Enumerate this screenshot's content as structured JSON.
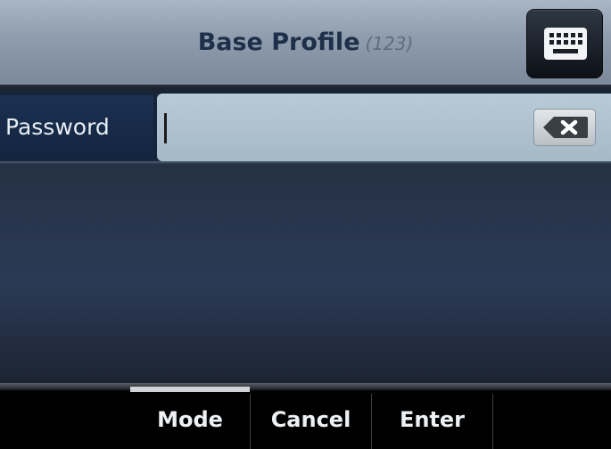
{
  "header": {
    "title": "Base Profile",
    "subtitle": "(123)",
    "keyboard_icon": "keyboard-icon"
  },
  "password_field": {
    "label": "Password",
    "value": "",
    "backspace_icon": "backspace-icon"
  },
  "softkeys": [
    {
      "label": ""
    },
    {
      "label": "Mode"
    },
    {
      "label": "Cancel"
    },
    {
      "label": "Enter"
    },
    {
      "label": ""
    }
  ],
  "colors": {
    "title_text": "#1e2f4a",
    "subtitle_text": "#5d6e85",
    "input_background": "#b8cad6",
    "softkey_bar": "#000000",
    "softkey_text": "#eef1f4"
  }
}
